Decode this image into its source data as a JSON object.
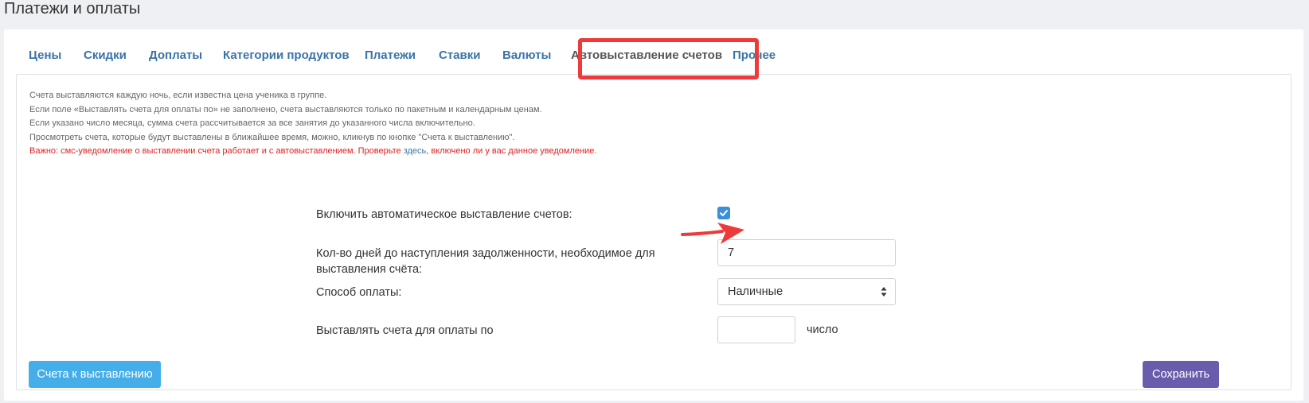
{
  "page": {
    "title": "Платежи и оплаты"
  },
  "tabs": [
    {
      "label": "Цены"
    },
    {
      "label": "Скидки"
    },
    {
      "label": "Доплаты"
    },
    {
      "label": "Категории продуктов"
    },
    {
      "label": "Платежи"
    },
    {
      "label": "Ставки"
    },
    {
      "label": "Валюты"
    },
    {
      "label": "Автовыставление счетов"
    },
    {
      "label": "Прочее"
    }
  ],
  "active_tab": "Автовыставление счетов",
  "info": {
    "line1": "Счета выставляются каждую ночь, если известна цена ученика в группе.",
    "line2": "Если поле «Выставлять счета для оплаты по» не заполнено, счета выставляются только по пакетным и календарным ценам.",
    "line3": "Если указано число месяца, сумма счета рассчитывается за все занятия до указанного числа включительно.",
    "line4": "Просмотреть счета, которые будут выставлены в ближайшее время, можно, кликнув по кнопке \"Счета к выставлению\".",
    "warning_pre": "Важно: смс-уведомление о выставлении счета работает и с автовыставлением. Проверьте ",
    "warning_link": "здесь",
    "warning_post": ", включено ли у вас данное уведомление."
  },
  "form": {
    "enable_label": "Включить автоматическое выставление счетов:",
    "enable_checked": true,
    "days_label_line1": "Кол-во дней до наступления задолженности, необходимое для",
    "days_label_line2": "выставления счёта:",
    "days_value": "7",
    "payment_label": "Способ оплаты:",
    "payment_value": "Наличные",
    "invoice_label": "Выставлять счета для оплаты по",
    "invoice_value": "",
    "invoice_suffix": "число"
  },
  "buttons": {
    "invoices_label": "Счета к выставлению",
    "save_label": "Сохранить"
  },
  "colors": {
    "link": "#3a73a8",
    "highlight": "#ee3a3a",
    "warning_text": "#e02020",
    "primary_button": "#45aee8",
    "save_button": "#6a5cac"
  },
  "icons": {
    "checkbox": "checkmark-icon",
    "select": "sort-arrows-icon",
    "annotation": "arrow-right-icon"
  }
}
